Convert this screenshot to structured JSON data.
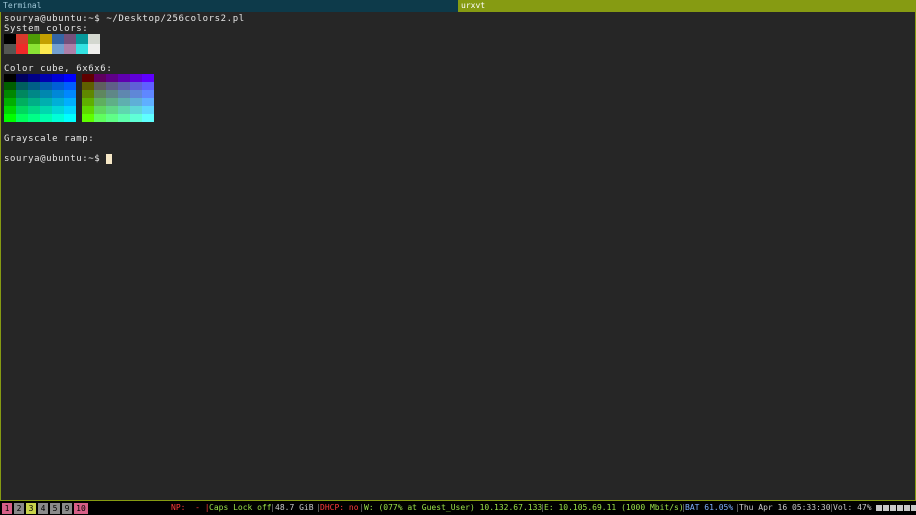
{
  "titlebar": {
    "left_title": "Terminal",
    "right_title": "urxvt"
  },
  "terminal": {
    "command_line": "sourya@ubuntu:~$ ~/Desktop/256colors2.pl",
    "system_colors_label": "System colors:",
    "system_colors_top": [
      "#000000",
      "#d7392c",
      "#4e9a06",
      "#c4a000",
      "#3465a4",
      "#75507b",
      "#06989a",
      "#d3d7cf"
    ],
    "system_colors_bottom": [
      "#555753",
      "#ef2929",
      "#8ae234",
      "#fce94f",
      "#729fcf",
      "#ad7fa8",
      "#34e2e2",
      "#eeeeec"
    ],
    "color_cube_label": "Color cube, 6x6x6:",
    "grayscale_label": "Grayscale ramp:",
    "prompt": "sourya@ubuntu:~$ "
  },
  "statusbar": {
    "workspaces": [
      {
        "label": "1",
        "color": "#d75f87"
      },
      {
        "label": "2",
        "color": "#8a8a8a"
      },
      {
        "label": "3",
        "color": "#c8d24b"
      },
      {
        "label": "4",
        "color": "#8a8a8a"
      },
      {
        "label": "5",
        "color": "#8a8a8a"
      },
      {
        "label": "9",
        "color": "#8a8a8a"
      },
      {
        "label": "10",
        "color": "#d75f87"
      }
    ],
    "np": "NP:  - |",
    "caps": "Caps Lock off",
    "disk": "48.7 GiB",
    "dhcp": "DHCP: no",
    "wifi": "W: (077% at Guest_User) 10.132.67.133",
    "eth": "E: 10.105.69.11 (1000 Mbit/s)",
    "battery": "BAT 61.05%",
    "datetime": "Thu Apr 16 05:33:30",
    "volume": "Vol: 47%",
    "tray_icons": [
      "keyboard-icon",
      "network-icon",
      "sync-icon",
      "chrome-icon",
      "volume-icon",
      "settings-icon"
    ]
  }
}
